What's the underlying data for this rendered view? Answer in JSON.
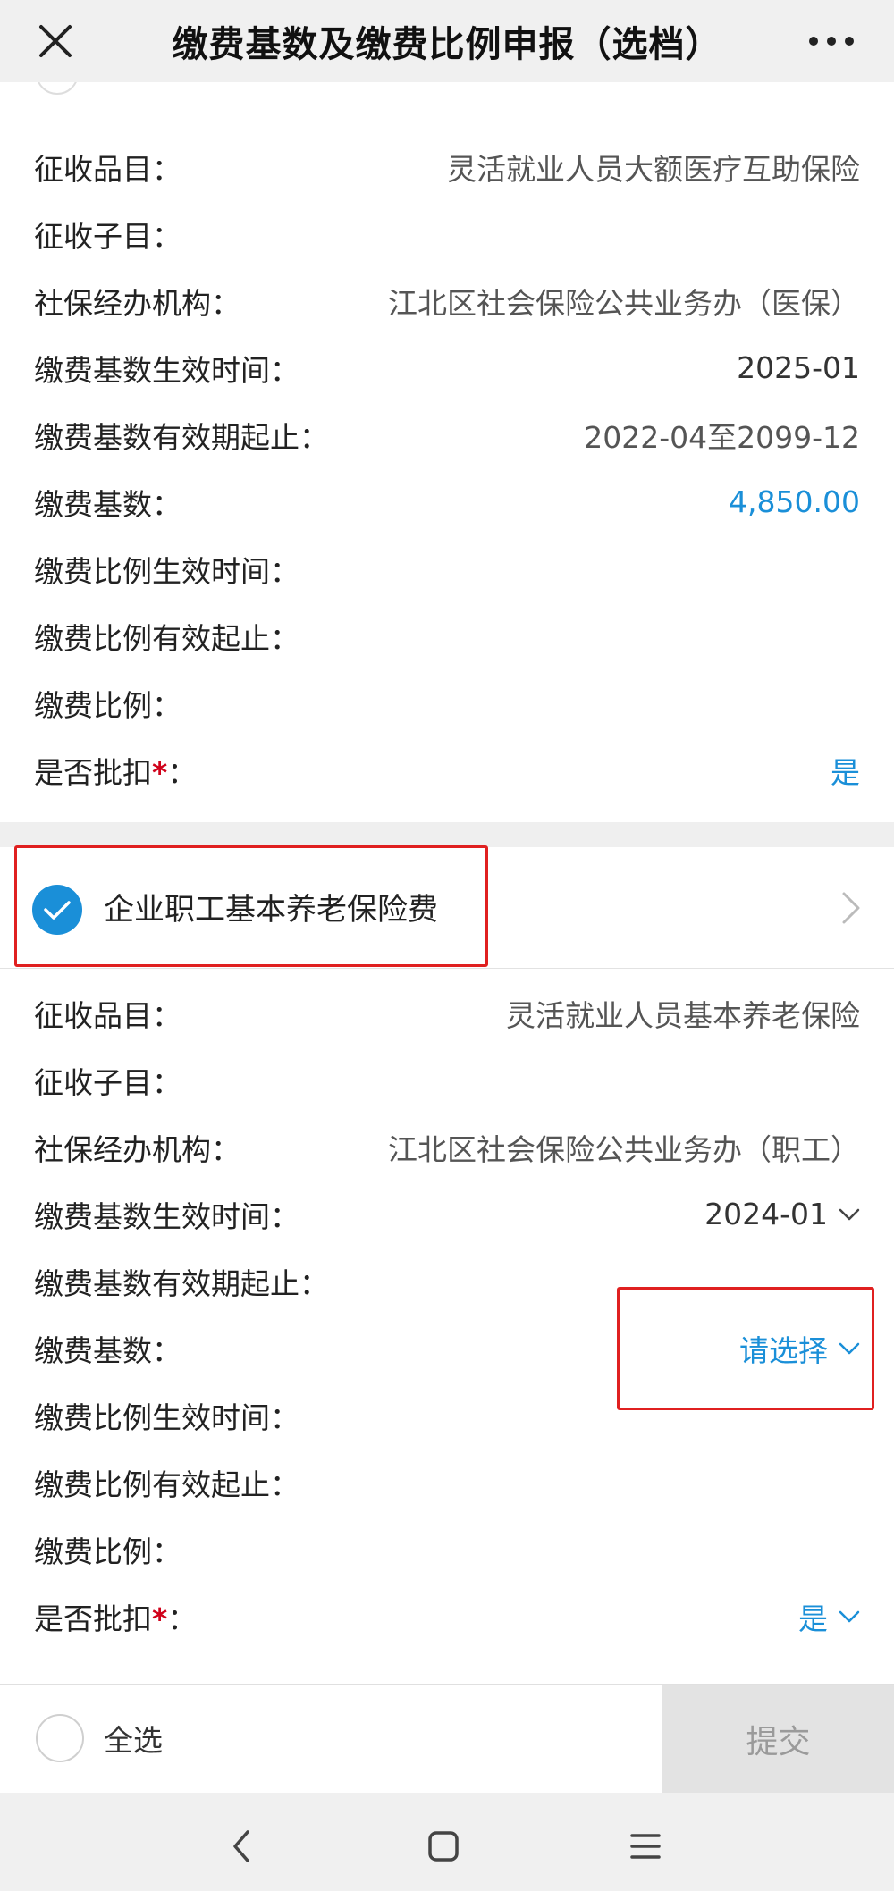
{
  "header": {
    "title": "缴费基数及缴费比例申报（选档）"
  },
  "section1": {
    "rows": [
      {
        "label": "征收品目：",
        "value": "灵活就业人员大额医疗互助保险"
      },
      {
        "label": "征收子目：",
        "value": ""
      },
      {
        "label": "社保经办机构：",
        "value": "江北区社会保险公共业务办（医保）"
      },
      {
        "label": "缴费基数生效时间：",
        "value": "2025-01"
      },
      {
        "label": "缴费基数有效期起止：",
        "value": "2022-04至2099-12"
      },
      {
        "label": "缴费基数：",
        "value": "4,850.00"
      },
      {
        "label": "缴费比例生效时间：",
        "value": ""
      },
      {
        "label": "缴费比例有效起止：",
        "value": ""
      },
      {
        "label": "缴费比例：",
        "value": ""
      },
      {
        "label": "是否批扣",
        "required_mark": "*",
        "colon": "：",
        "value": "是"
      }
    ]
  },
  "section2": {
    "title": "企业职工基本养老保险费",
    "checked": true,
    "rows": [
      {
        "label": "征收品目：",
        "value": "灵活就业人员基本养老保险"
      },
      {
        "label": "征收子目：",
        "value": ""
      },
      {
        "label": "社保经办机构：",
        "value": "江北区社会保险公共业务办（职工）"
      },
      {
        "label": "缴费基数生效时间：",
        "value": "2024-01"
      },
      {
        "label": "缴费基数有效期起止：",
        "value": ""
      },
      {
        "label": "缴费基数：",
        "value": "请选择"
      },
      {
        "label": "缴费比例生效时间：",
        "value": ""
      },
      {
        "label": "缴费比例有效起止：",
        "value": ""
      },
      {
        "label": "缴费比例：",
        "value": ""
      },
      {
        "label": "是否批扣",
        "required_mark": "*",
        "colon": "：",
        "value": "是"
      }
    ]
  },
  "footer": {
    "select_all_label": "全选",
    "submit_label": "提交"
  },
  "colors": {
    "accent_blue": "#1a8fd8",
    "highlight_red": "#e02020",
    "required_red": "#d0021b"
  },
  "icons": [
    "close-icon",
    "more-icon",
    "check-icon",
    "chevron-right-icon",
    "chevron-down-icon",
    "back-icon",
    "home-icon",
    "menu-icon"
  ]
}
